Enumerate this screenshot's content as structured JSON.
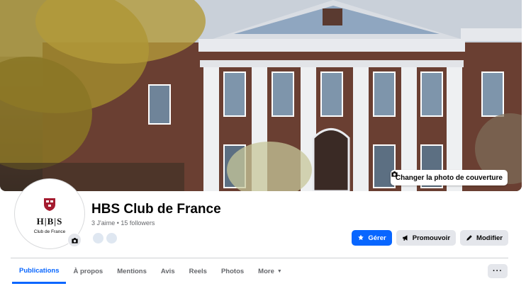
{
  "cover": {
    "change_button_label": "Changer la photo de couverture",
    "icon": "camera-icon"
  },
  "profile": {
    "avatar_monogram": "H|B|S",
    "avatar_caption": "Club de France",
    "name": "HBS Club de France",
    "meta": "3 J'aime • 15 followers"
  },
  "actions": {
    "manage_label": "Gérer",
    "promote_label": "Promouvoir",
    "edit_label": "Modifier"
  },
  "tabs": [
    {
      "label": "Publications",
      "active": true
    },
    {
      "label": "À propos"
    },
    {
      "label": "Mentions"
    },
    {
      "label": "Avis"
    },
    {
      "label": "Reels"
    },
    {
      "label": "Photos"
    },
    {
      "label": "More"
    }
  ],
  "more_menu_label": "···",
  "colors": {
    "accent": "#0866ff",
    "secondary_button": "#e4e6eb",
    "muted_text": "#65676b"
  }
}
